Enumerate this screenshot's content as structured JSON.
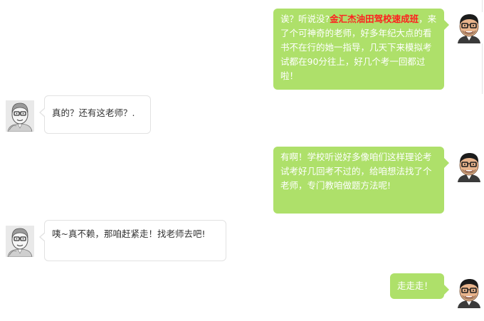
{
  "colors": {
    "outgoing_bubble": "#aee06a",
    "outgoing_text": "#ffffff",
    "incoming_bubble": "#ffffff",
    "incoming_text": "#333333",
    "highlight": "#ff1f1f"
  },
  "messages": [
    {
      "side": "right",
      "avatar": "student-avatar",
      "prefix": "诶？听说没?",
      "highlight": "金汇杰油田驾校速成班",
      "suffix": "，来了个可神奇的老师，好多年纪大点的看书不在行的她一指导，几天下来模拟考试都在90分往上，好几个考一回都过啦！"
    },
    {
      "side": "left",
      "avatar": "teacher-avatar",
      "text": "真的？还有这老师？."
    },
    {
      "side": "right",
      "avatar": "student-avatar",
      "text": "有啊！学校听说好多像咱们这样理论考试考好几回考不过的，给咱想法找了个老师，专门教咱做题方法呢!"
    },
    {
      "side": "left",
      "avatar": "teacher-avatar",
      "text": "咦~真不赖，那咱赶紧走！找老师去吧!"
    },
    {
      "side": "right",
      "avatar": "student-avatar",
      "text": "走走走！"
    }
  ]
}
